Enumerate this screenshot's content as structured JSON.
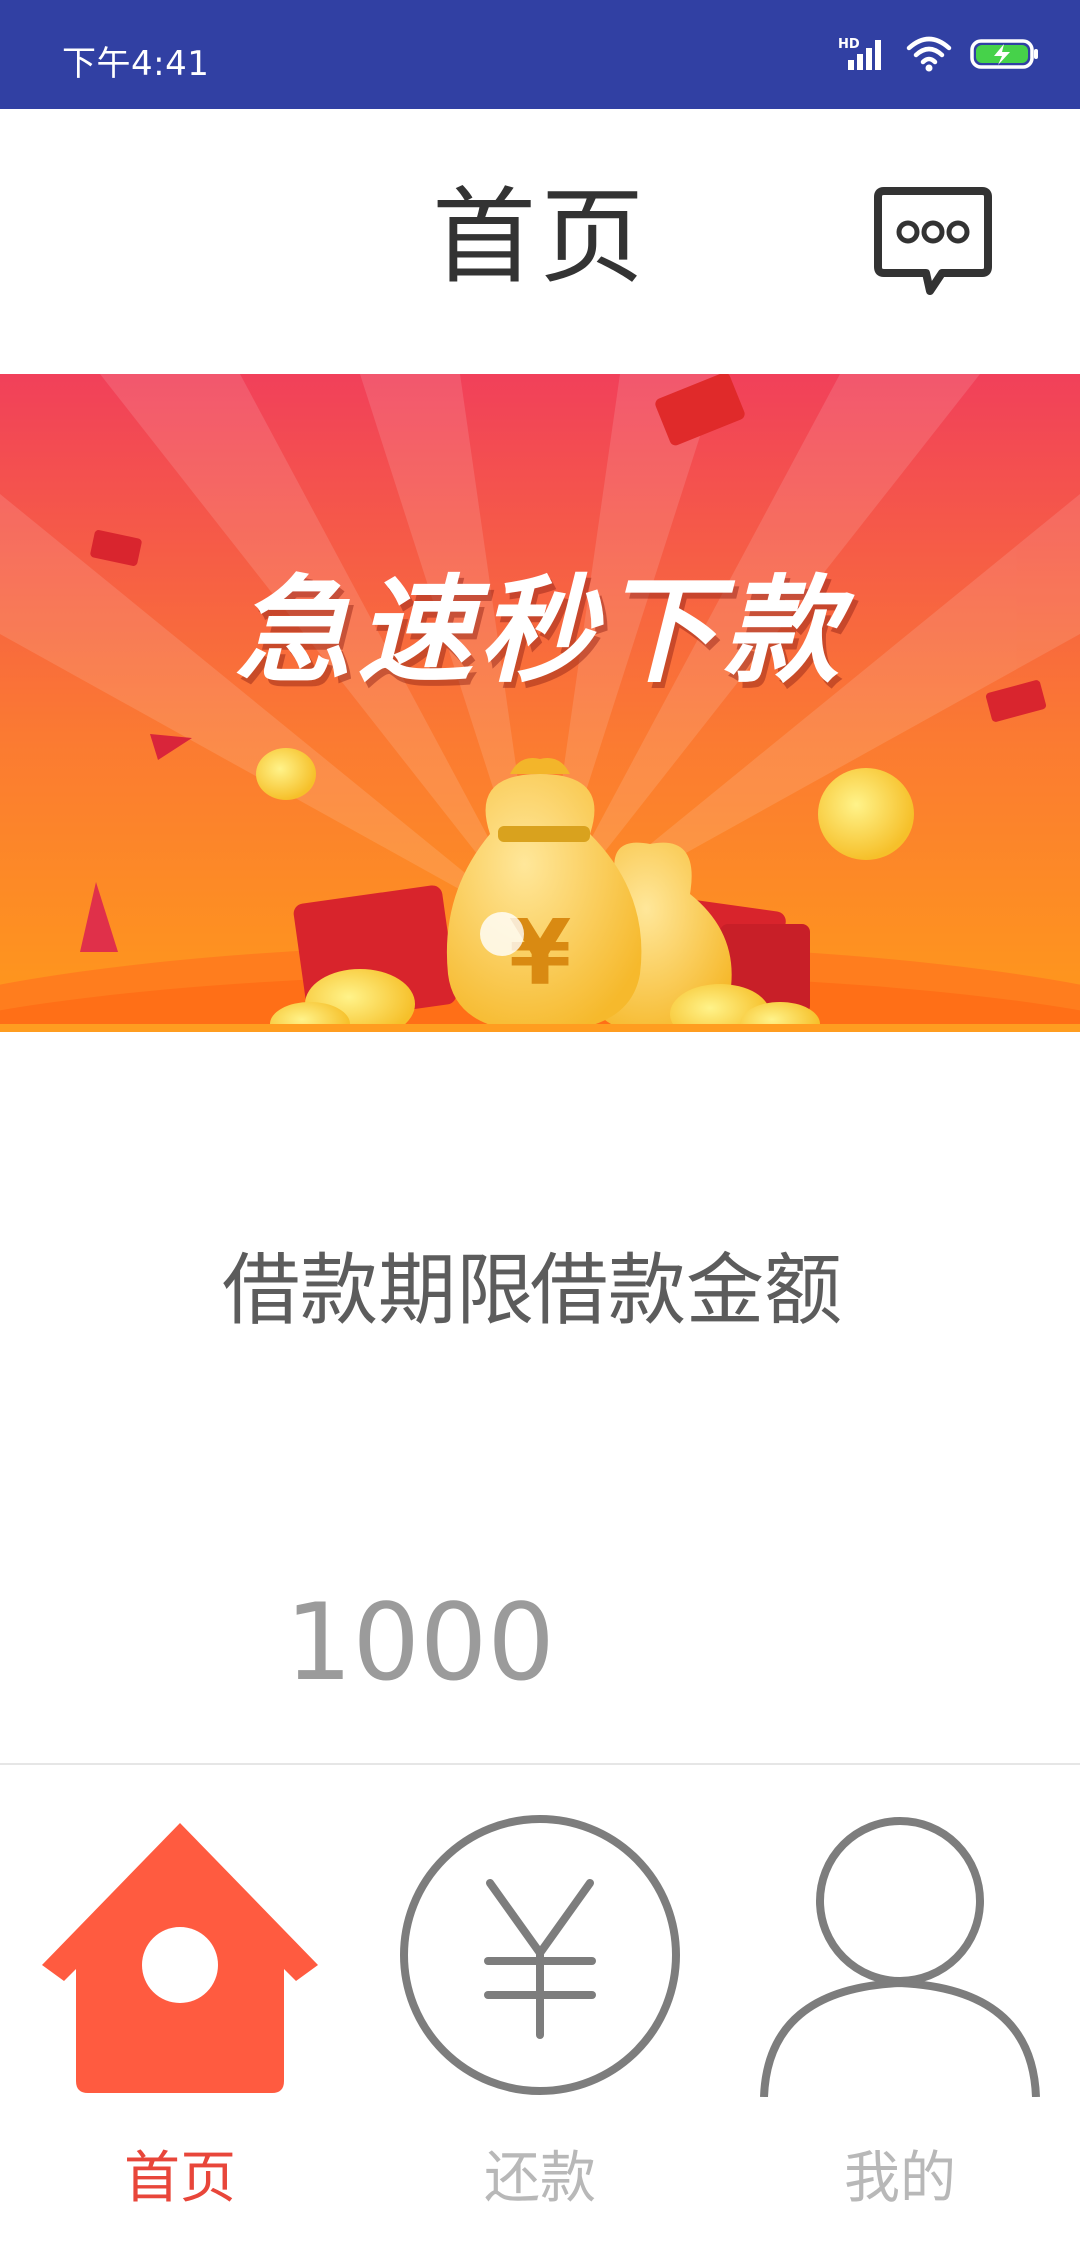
{
  "status_bar": {
    "time": "下午4:41",
    "network_label": "HD",
    "icons": [
      "signal-icon",
      "wifi-icon",
      "battery-charging-icon"
    ]
  },
  "header": {
    "title": "首页",
    "message_icon": "message-bubble-icon"
  },
  "banner": {
    "title": "急速秒下款"
  },
  "loan": {
    "term_label": "借款期限",
    "amount_label": "借款金额",
    "amount_value": "1000"
  },
  "bottom_nav": {
    "items": [
      {
        "label": "首页",
        "icon": "home-icon",
        "active": true
      },
      {
        "label": "还款",
        "icon": "yuan-circle-icon",
        "active": false
      },
      {
        "label": "我的",
        "icon": "user-icon",
        "active": false
      }
    ]
  },
  "colors": {
    "status_bar": "#3140a3",
    "accent": "#e8463a",
    "home_icon": "#ff5b40",
    "inactive": "#b8b8b8",
    "banner_top": "#f1405a",
    "banner_bottom": "#ff9a1a"
  }
}
